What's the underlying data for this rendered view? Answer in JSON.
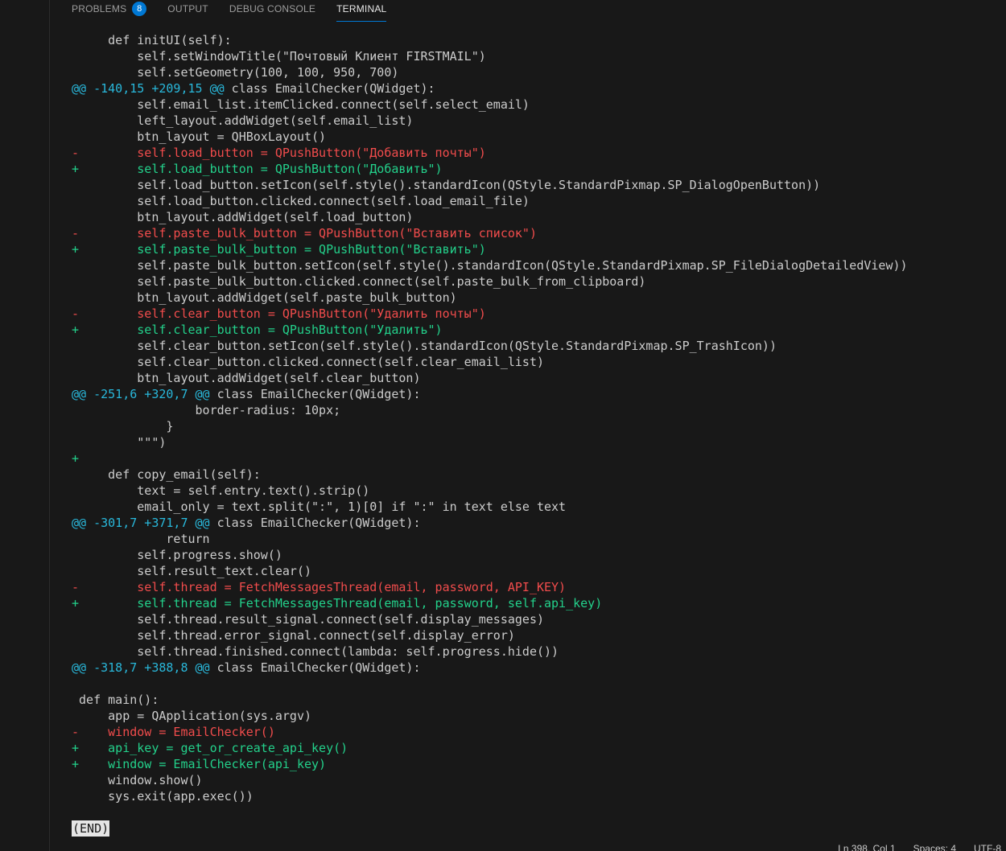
{
  "tabs": [
    {
      "label": "PROBLEMS",
      "badge": "8"
    },
    {
      "label": "OUTPUT"
    },
    {
      "label": "DEBUG CONSOLE"
    },
    {
      "label": "TERMINAL",
      "active": true
    }
  ],
  "terminal": {
    "lines": [
      {
        "kind": "ctx",
        "text": "     def initUI(self):"
      },
      {
        "kind": "ctx",
        "text": "         self.setWindowTitle(\"Почтовый Клиент FIRSTMAIL\")"
      },
      {
        "kind": "ctx",
        "text": "         self.setGeometry(100, 100, 950, 700)"
      },
      {
        "kind": "hunk",
        "meta": "@@ -140,15 +209,15 @@",
        "text": " class EmailChecker(QWidget):"
      },
      {
        "kind": "ctx",
        "text": "         self.email_list.itemClicked.connect(self.select_email)"
      },
      {
        "kind": "ctx",
        "text": "         left_layout.addWidget(self.email_list)"
      },
      {
        "kind": "ctx",
        "text": "         btn_layout = QHBoxLayout()"
      },
      {
        "kind": "del",
        "text": "-        self.load_button = QPushButton(\"Добавить почты\")"
      },
      {
        "kind": "add",
        "text": "+        self.load_button = QPushButton(\"Добавить\")"
      },
      {
        "kind": "ctx",
        "text": "         self.load_button.setIcon(self.style().standardIcon(QStyle.StandardPixmap.SP_DialogOpenButton))"
      },
      {
        "kind": "ctx",
        "text": "         self.load_button.clicked.connect(self.load_email_file)"
      },
      {
        "kind": "ctx",
        "text": "         btn_layout.addWidget(self.load_button)"
      },
      {
        "kind": "del",
        "text": "-        self.paste_bulk_button = QPushButton(\"Вставить список\")"
      },
      {
        "kind": "add",
        "text": "+        self.paste_bulk_button = QPushButton(\"Вставить\")"
      },
      {
        "kind": "ctx",
        "text": "         self.paste_bulk_button.setIcon(self.style().standardIcon(QStyle.StandardPixmap.SP_FileDialogDetailedView))"
      },
      {
        "kind": "ctx",
        "text": "         self.paste_bulk_button.clicked.connect(self.paste_bulk_from_clipboard)"
      },
      {
        "kind": "ctx",
        "text": "         btn_layout.addWidget(self.paste_bulk_button)"
      },
      {
        "kind": "del",
        "text": "-        self.clear_button = QPushButton(\"Удалить почты\")"
      },
      {
        "kind": "add",
        "text": "+        self.clear_button = QPushButton(\"Удалить\")"
      },
      {
        "kind": "ctx",
        "text": "         self.clear_button.setIcon(self.style().standardIcon(QStyle.StandardPixmap.SP_TrashIcon))"
      },
      {
        "kind": "ctx",
        "text": "         self.clear_button.clicked.connect(self.clear_email_list)"
      },
      {
        "kind": "ctx",
        "text": "         btn_layout.addWidget(self.clear_button)"
      },
      {
        "kind": "hunk",
        "meta": "@@ -251,6 +320,7 @@",
        "text": " class EmailChecker(QWidget):"
      },
      {
        "kind": "ctx",
        "text": "                 border-radius: 10px;"
      },
      {
        "kind": "ctx",
        "text": "             }"
      },
      {
        "kind": "ctx",
        "text": "         \"\"\")"
      },
      {
        "kind": "add",
        "text": "+"
      },
      {
        "kind": "ctx",
        "text": "     def copy_email(self):"
      },
      {
        "kind": "ctx",
        "text": "         text = self.entry.text().strip()"
      },
      {
        "kind": "ctx",
        "text": "         email_only = text.split(\":\", 1)[0] if \":\" in text else text"
      },
      {
        "kind": "hunk",
        "meta": "@@ -301,7 +371,7 @@",
        "text": " class EmailChecker(QWidget):"
      },
      {
        "kind": "ctx",
        "text": "             return"
      },
      {
        "kind": "ctx",
        "text": "         self.progress.show()"
      },
      {
        "kind": "ctx",
        "text": "         self.result_text.clear()"
      },
      {
        "kind": "del",
        "text": "-        self.thread = FetchMessagesThread(email, password, API_KEY)"
      },
      {
        "kind": "add",
        "text": "+        self.thread = FetchMessagesThread(email, password, self.api_key)"
      },
      {
        "kind": "ctx",
        "text": "         self.thread.result_signal.connect(self.display_messages)"
      },
      {
        "kind": "ctx",
        "text": "         self.thread.error_signal.connect(self.display_error)"
      },
      {
        "kind": "ctx",
        "text": "         self.thread.finished.connect(lambda: self.progress.hide())"
      },
      {
        "kind": "hunk",
        "meta": "@@ -318,7 +388,8 @@",
        "text": " class EmailChecker(QWidget):"
      },
      {
        "kind": "ctx",
        "text": ""
      },
      {
        "kind": "ctx",
        "text": " def main():"
      },
      {
        "kind": "ctx",
        "text": "     app = QApplication(sys.argv)"
      },
      {
        "kind": "del",
        "text": "-    window = EmailChecker()"
      },
      {
        "kind": "add",
        "text": "+    api_key = get_or_create_api_key()"
      },
      {
        "kind": "add",
        "text": "+    window = EmailChecker(api_key)"
      },
      {
        "kind": "ctx",
        "text": "     window.show()"
      },
      {
        "kind": "ctx",
        "text": "     sys.exit(app.exec())"
      },
      {
        "kind": "ctx",
        "text": ""
      },
      {
        "kind": "end",
        "text": "(END)"
      }
    ]
  },
  "statusbar": {
    "position": "Ln 398, Col 1",
    "spaces": "Spaces: 4",
    "encoding": "UTF-8"
  },
  "colors": {
    "background": "#181818",
    "text": "#cccccc",
    "deleted": "#f14c4c",
    "added": "#23d18b",
    "hunk_header": "#29b8db",
    "accent": "#0078d4"
  }
}
